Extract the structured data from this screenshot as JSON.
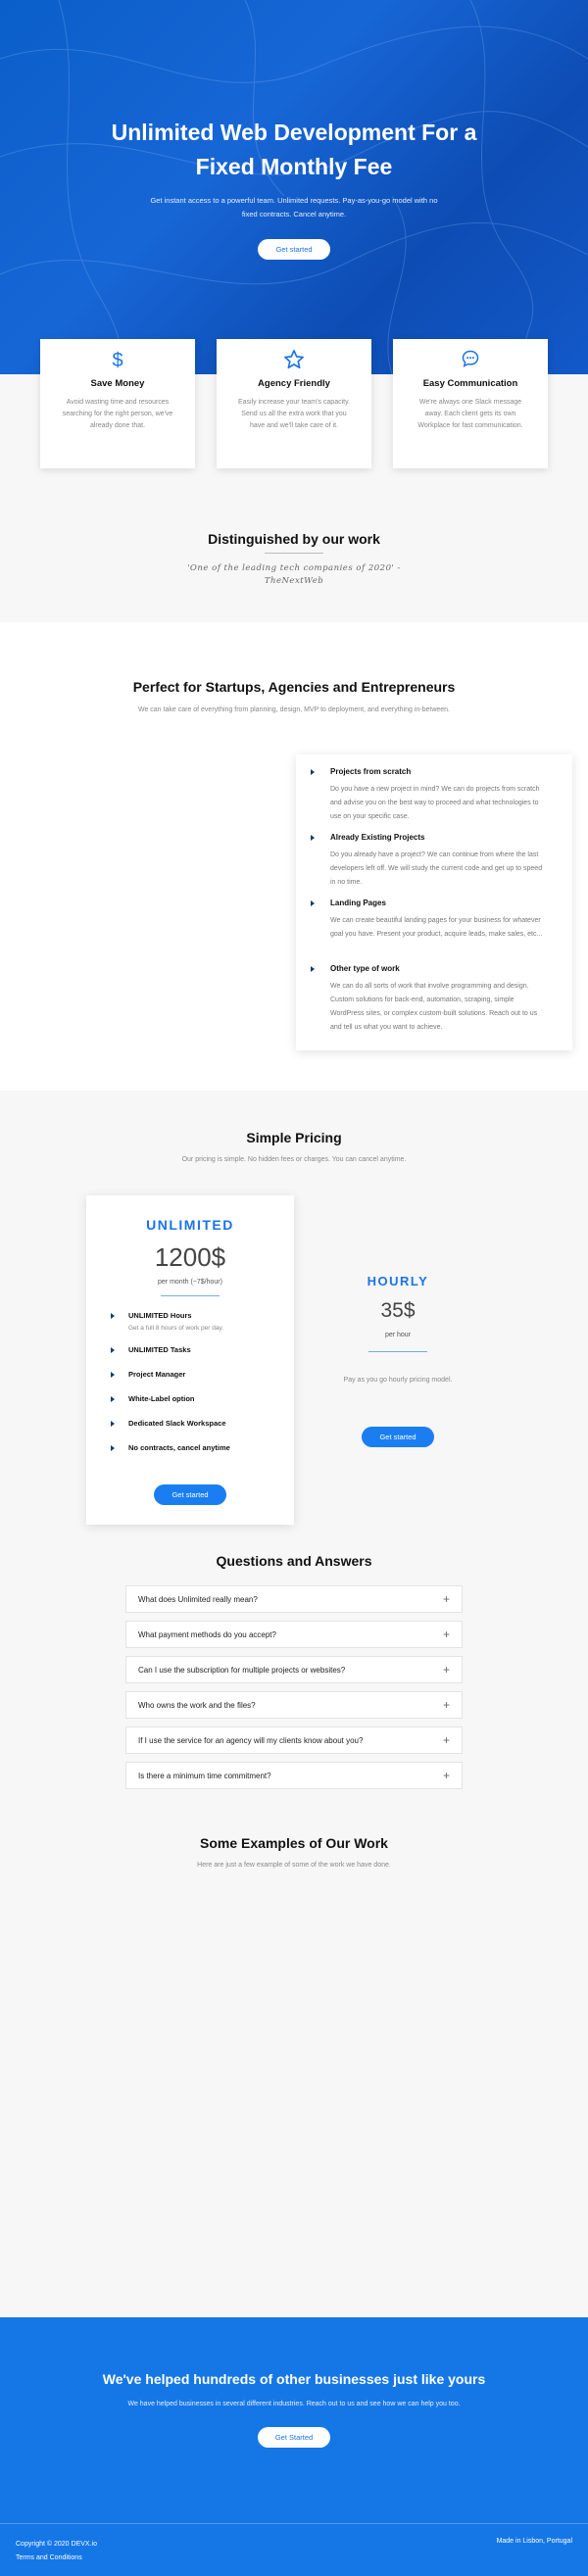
{
  "hero": {
    "title": "Unlimited Web Development For a Fixed Monthly Fee",
    "subtitle": "Get instant access to a powerful team. Unlimited requests. Pay-as-you-go model with no fixed contracts. Cancel anytime.",
    "cta_label": "Get started"
  },
  "features": [
    {
      "icon": "dollar-icon",
      "title": "Save Money",
      "text": "Avoid wasting time and resources searching for the right person, we've already done that."
    },
    {
      "icon": "star-icon",
      "title": "Agency Friendly",
      "text": "Easily increase your team's capacity. Send us all the extra work that you have and we'll take care of it."
    },
    {
      "icon": "chat-icon",
      "title": "Easy Communication",
      "text": "We're always one Slack message away. Each client gets its own Workplace for fast communication."
    }
  ],
  "distinguished": {
    "title": "Distinguished by our work",
    "quote": "'One of the leading tech companies of 2020' - TheNextWeb"
  },
  "perfect": {
    "title": "Perfect for Startups, Agencies and Entrepreneurs",
    "subtitle": "We can take care of everything from planning, design, MVP to deployment, and everything in-between.",
    "items": [
      {
        "title": "Projects from scratch",
        "text": "Do you have a new project in mind? We can do projects from scratch and advise you on the best way to proceed and what technologies to use on your specific case."
      },
      {
        "title": "Already Existing Projects",
        "text": "Do you already have a project? We can continue from where the last developers left off. We will study the current code and get up to speed in no time."
      },
      {
        "title": "Landing Pages",
        "text": "We can create beautiful landing pages for your business for whatever goal you have. Present your product, acquire leads, make sales, etc..."
      },
      {
        "title": "Other type of work",
        "text": "We can do all sorts of work that involve programming and design. Custom solutions for back-end, automation, scraping, simple WordPress sites, or complex custom-built solutions. Reach out to us and tell us what you want to achieve."
      }
    ]
  },
  "pricing": {
    "title": "Simple Pricing",
    "subtitle": "Our pricing is simple. No hidden fees or charges. You can cancel anytime.",
    "unlimited": {
      "name": "UNLIMITED",
      "price": "1200$",
      "period": "per month (~7$/hour)",
      "features": [
        {
          "label": "UNLIMITED Hours",
          "note": "Get a full 8 hours of work per day."
        },
        {
          "label": "UNLIMITED Tasks",
          "note": ""
        },
        {
          "label": "Project Manager",
          "note": ""
        },
        {
          "label": "White-Label option",
          "note": ""
        },
        {
          "label": "Dedicated Slack Workspace",
          "note": ""
        },
        {
          "label": "No contracts, cancel anytime",
          "note": ""
        }
      ],
      "cta_label": "Get started"
    },
    "hourly": {
      "name": "HOURLY",
      "price": "35$",
      "period": "per hour",
      "note": "Pay as you go hourly pricing model.",
      "cta_label": "Get started"
    }
  },
  "faq": {
    "title": "Questions and Answers",
    "items": [
      "What does Unlimited really mean?",
      "What payment methods do you accept?",
      "Can I use the subscription for multiple projects or websites?",
      "Who owns the work and the files?",
      "If I use the service for an agency will my clients know about you?",
      "Is there a minimum time commitment?"
    ]
  },
  "examples": {
    "title": "Some Examples of Our Work",
    "subtitle": "Here are just a few example of some of the work we have done."
  },
  "cta": {
    "title": "We've helped hundreds of other businesses just like yours",
    "subtitle": "We have helped businesses in several different industries. Reach out to us and see how we can help you too.",
    "button_label": "Get Started"
  },
  "footer": {
    "copyright": "Copyright © 2020 DEVX.io",
    "terms": "Terms and Conditions",
    "made_in": "Made in Lisbon, Portugal"
  },
  "colors": {
    "accent": "#1a73e8",
    "hero_dark": "#0b5fc9",
    "cta_bg": "#1577e6"
  }
}
